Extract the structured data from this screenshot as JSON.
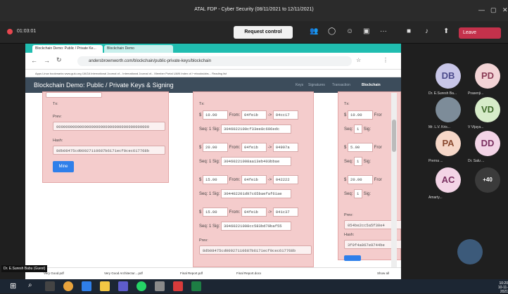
{
  "window": {
    "title": "ATAL FDP - Cyber Security (08/11/2021 to 12/11/2021)"
  },
  "meeting": {
    "timer": "01:03:01",
    "request_control": "Request control",
    "leave": "Leave"
  },
  "browser": {
    "tab1": "Blockchain Demo: Public / Private Ke...",
    "tab2": "Blockchain Demo",
    "url": "andersbrownworth.com/blockchain/public-private-keys/blockchain",
    "bookmarks": "Apps   Linux bookmarks   www.gulu.org   IJAGA   International Journal of...   International Journal of...   Member Portal UAIN   Index of /~ebooks/abs...   Reading list"
  },
  "app": {
    "title": "Blockchain Demo: Public / Private Keys & Signing",
    "nav": [
      "Keys",
      "Signatures",
      "Transaction",
      "Blockchain"
    ]
  },
  "block1": {
    "tx_label": "Tx:",
    "prev_label": "Prev:",
    "prev": "0000000000000000000000000000000000000000",
    "hash_label": "Hash:",
    "hash": "8db08475cd00927110687b6171ecf0cec617768b",
    "mine": "Mine"
  },
  "block2": {
    "tx_label": "Tx:",
    "txs": [
      {
        "amount": "10.00",
        "from": "04fe1b",
        "to": "04cc17",
        "seq": "1",
        "sig": "3046022100cf33ee8c696edc"
      },
      {
        "amount": "20.00",
        "from": "04fe1b",
        "to": "04997a",
        "seq": "1",
        "sig": "30460221008aa13eb403bbae"
      },
      {
        "amount": "15.00",
        "from": "04fe1b",
        "to": "042222",
        "seq": "1",
        "sig": "304402201d97c65baefaf61ae"
      },
      {
        "amount": "15.00",
        "from": "04fe1b",
        "to": "041c37",
        "seq": "1",
        "sig": "30460221008cc583bd79baf55"
      }
    ],
    "prev_label": "Prev:",
    "prev": "8db08475cd00927110687b6171ecf0cec617768b"
  },
  "block3": {
    "tx_label": "Tx:",
    "txs": [
      {
        "amount": "10.00",
        "from": "Fror"
      },
      {
        "amount": "5.00",
        "from": "Fror"
      },
      {
        "amount": "20.00",
        "from": "Fror"
      }
    ],
    "prev_label": "Prev:",
    "prev": "054be2cc5a5f30e4",
    "hash_label": "Hash:",
    "hash": "3f0f4a067e9744be"
  },
  "labels": {
    "dollar": "$",
    "from": "From:",
    "arrow": "->",
    "seq": "Seq:",
    "sig": "Sig:"
  },
  "downloads": [
    "Very Good.pdf",
    "Very Good Architectur....pdf",
    "Final Report.pdf",
    "Final Report.docx",
    "Show all"
  ],
  "presenter": "Dr. E.Suresh Babu (Guest)",
  "participants": [
    {
      "initials": "DB",
      "name": "Dr. E.Suresh Ba...",
      "color": "#c8c6e8",
      "text": "#4b4a8a"
    },
    {
      "initials": "PD",
      "name": "Prasenji...",
      "color": "#f3d4d6",
      "text": "#8a3b55"
    },
    {
      "initials": "",
      "name": "Mr. L.V. Kris...",
      "color": "#7d8c99",
      "text": "#fff"
    },
    {
      "initials": "VD",
      "name": "V Vijaya...",
      "color": "#d7ecc9",
      "text": "#3f6b2a"
    },
    {
      "initials": "PA",
      "name": "Prerna ...",
      "color": "#f6d7c8",
      "text": "#8a4a2f"
    },
    {
      "initials": "DD",
      "name": "Dr. Salu ...",
      "color": "#f3d4e6",
      "text": "#7a2f60"
    },
    {
      "initials": "AC",
      "name": "Amarty...",
      "color": "#f3d4e6",
      "text": "#7a2f60"
    },
    {
      "initials": "+40",
      "name": "",
      "color": "#3b3b3b",
      "text": "#fff"
    }
  ],
  "clock": {
    "time": "10:20",
    "date": "10-11-2021"
  }
}
